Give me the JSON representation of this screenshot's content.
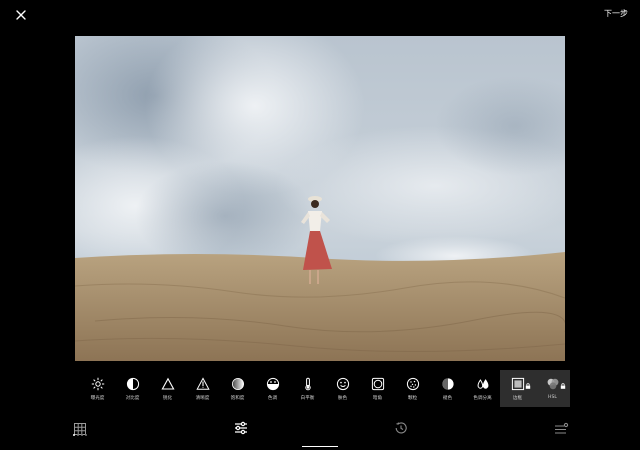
{
  "header": {
    "close_icon": "close-icon",
    "next_label": "下一步"
  },
  "tools": [
    {
      "icon": "exposure-icon",
      "label": "曝光度",
      "active": false,
      "locked": false
    },
    {
      "icon": "contrast-icon",
      "label": "对比度",
      "active": false,
      "locked": false
    },
    {
      "icon": "sharpen-icon",
      "label": "锐化",
      "active": false,
      "locked": false
    },
    {
      "icon": "clarity-icon",
      "label": "清晰度",
      "active": false,
      "locked": false
    },
    {
      "icon": "saturation-icon",
      "label": "饱和度",
      "active": false,
      "locked": false
    },
    {
      "icon": "tone-icon",
      "label": "色调",
      "active": false,
      "locked": false
    },
    {
      "icon": "white-balance-icon",
      "label": "白平衡",
      "active": false,
      "locked": false
    },
    {
      "icon": "skin-tone-icon",
      "label": "肤色",
      "active": false,
      "locked": false
    },
    {
      "icon": "vignette-icon",
      "label": "暗角",
      "active": false,
      "locked": false
    },
    {
      "icon": "grain-icon",
      "label": "颗粒",
      "active": false,
      "locked": false
    },
    {
      "icon": "fade-icon",
      "label": "褪色",
      "active": false,
      "locked": false
    },
    {
      "icon": "split-tone-icon",
      "label": "色调分离",
      "active": false,
      "locked": false
    },
    {
      "icon": "borders-icon",
      "label": "边框",
      "active": true,
      "locked": true
    },
    {
      "icon": "hsl-icon",
      "label": "HSL",
      "active": true,
      "locked": true
    }
  ],
  "bottom_nav": {
    "presets_icon": "grid-presets-icon",
    "adjust_icon": "sliders-icon",
    "history_icon": "history-icon",
    "recipes_icon": "recipes-icon",
    "active_tab": "adjust"
  },
  "colors": {
    "background": "#000000",
    "active_tool_bg": "#2e2e2e",
    "label": "#cfcfcf"
  }
}
